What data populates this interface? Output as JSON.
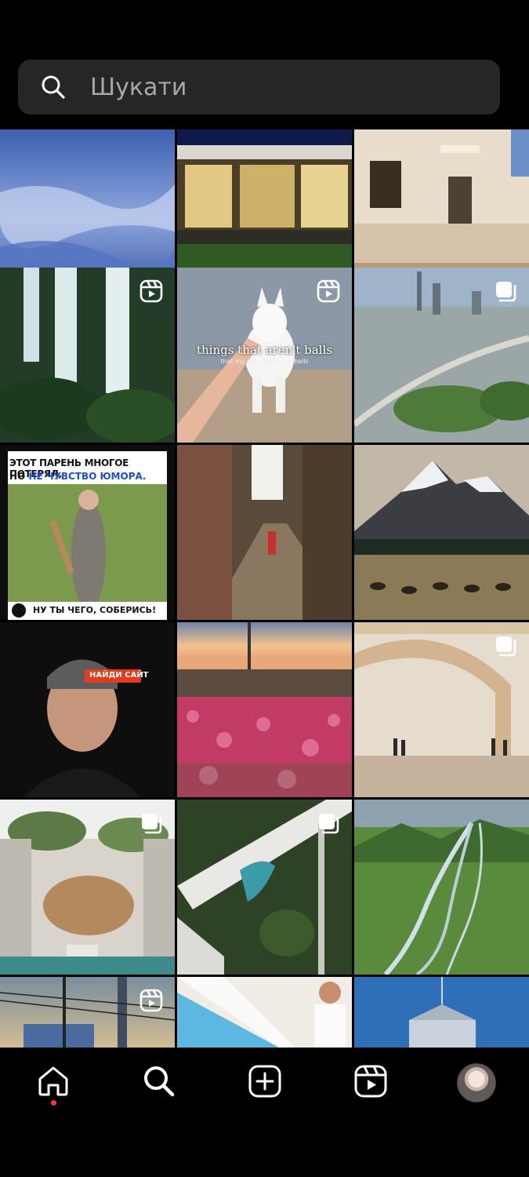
{
  "search": {
    "placeholder": "Шукати",
    "icon": "search-icon"
  },
  "tiles": [
    {
      "id": "sky",
      "type": "image",
      "badge": null
    },
    {
      "id": "glass-house",
      "type": "image",
      "badge": null
    },
    {
      "id": "mansion",
      "type": "image",
      "badge": null
    },
    {
      "id": "waterfall",
      "type": "reel",
      "badge": "reels-icon"
    },
    {
      "id": "dog",
      "type": "reel",
      "badge": "reels-icon",
      "caption": "things that aren't balls",
      "subcaption": "that my dog thinks are balls"
    },
    {
      "id": "dubai",
      "type": "carousel",
      "badge": "carousel-icon"
    },
    {
      "id": "meme",
      "type": "image",
      "badge": null,
      "headline_1": "ЭТОТ ПАРЕНЬ МНОГОЕ ПОТЕРЯЛ,",
      "headline_2_prefix": "НО",
      "headline_2_accent": "НЕ ЧУВСТВО ЮМОРА.",
      "footer": "НУ ТЫ ЧЕГО, СОБЕРИСЬ!",
      "cap_label": "НАЙДИ САЙТ"
    },
    {
      "id": "market",
      "type": "image",
      "badge": null
    },
    {
      "id": "mountains",
      "type": "image",
      "badge": null
    },
    {
      "id": "flowers",
      "type": "image",
      "badge": null
    },
    {
      "id": "wood-arch",
      "type": "carousel",
      "badge": "carousel-icon"
    },
    {
      "id": "concrete-patio",
      "type": "carousel",
      "badge": "carousel-icon"
    },
    {
      "id": "pool-aerial",
      "type": "carousel",
      "badge": "carousel-icon"
    },
    {
      "id": "river-valley",
      "type": "image",
      "badge": null
    },
    {
      "id": "city-wires",
      "type": "reel",
      "badge": "reels-icon"
    },
    {
      "id": "pool-man",
      "type": "image",
      "badge": null
    },
    {
      "id": "water-tower",
      "type": "image",
      "badge": null
    }
  ],
  "nav": [
    {
      "name": "home",
      "icon": "home-icon",
      "active": true
    },
    {
      "name": "search",
      "icon": "search-icon",
      "active": false
    },
    {
      "name": "create",
      "icon": "create-icon",
      "active": false
    },
    {
      "name": "reels",
      "icon": "reels-icon",
      "active": false
    },
    {
      "name": "profile",
      "icon": "avatar",
      "active": false
    }
  ],
  "colors": {
    "background": "#000000",
    "search_bg": "#262626",
    "placeholder": "#a8a8a8",
    "notification_dot": "#ff3040",
    "accent_blue": "#1a4fd6"
  }
}
